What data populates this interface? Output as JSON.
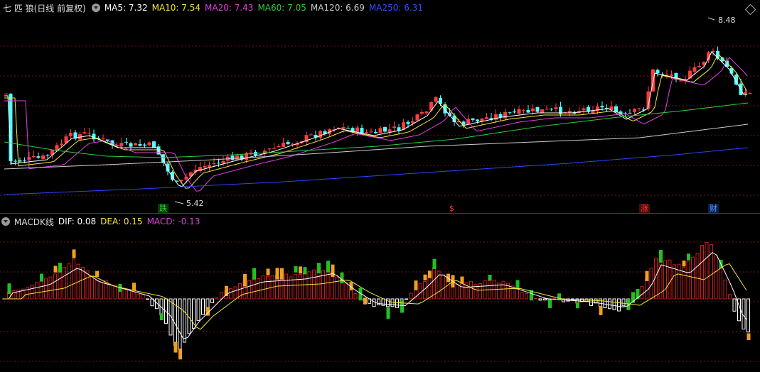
{
  "price_pane": {
    "title": "七 匹 狼(日线 前复权)",
    "mas": [
      {
        "label": "MA5: 7.32",
        "color": "#ffffff"
      },
      {
        "label": "MA10: 7.54",
        "color": "#f5e63c"
      },
      {
        "label": "MA20: 7.43",
        "color": "#e040e0"
      },
      {
        "label": "MA60: 7.05",
        "color": "#2ecc40"
      },
      {
        "label": "MA120: 6.69",
        "color": "#cccccc"
      },
      {
        "label": "MA250: 6.31",
        "color": "#3050ff"
      }
    ],
    "high_marker": "8.48",
    "low_marker": "5.42",
    "events": [
      {
        "text": "跌",
        "color": "#2ecc40"
      },
      {
        "text": "$",
        "color": "#ff3333"
      },
      {
        "text": "涨",
        "color": "#ff3333"
      },
      {
        "text": "财",
        "color": "#3b7bff"
      }
    ]
  },
  "macd_pane": {
    "title": "MACDK线",
    "dif": "DIF: 0.08",
    "dea": "DEA: 0.15",
    "macd": "MACD: -0.13",
    "dif_color": "#ffffff",
    "dea_color": "#f5e63c",
    "macd_color": "#e040e0"
  },
  "colors": {
    "up": "#ff3c3c",
    "down": "#54ffff",
    "grid": "#7a1010",
    "macd_pos": "#c81e1e",
    "macd_neg": "#ffffff"
  }
}
